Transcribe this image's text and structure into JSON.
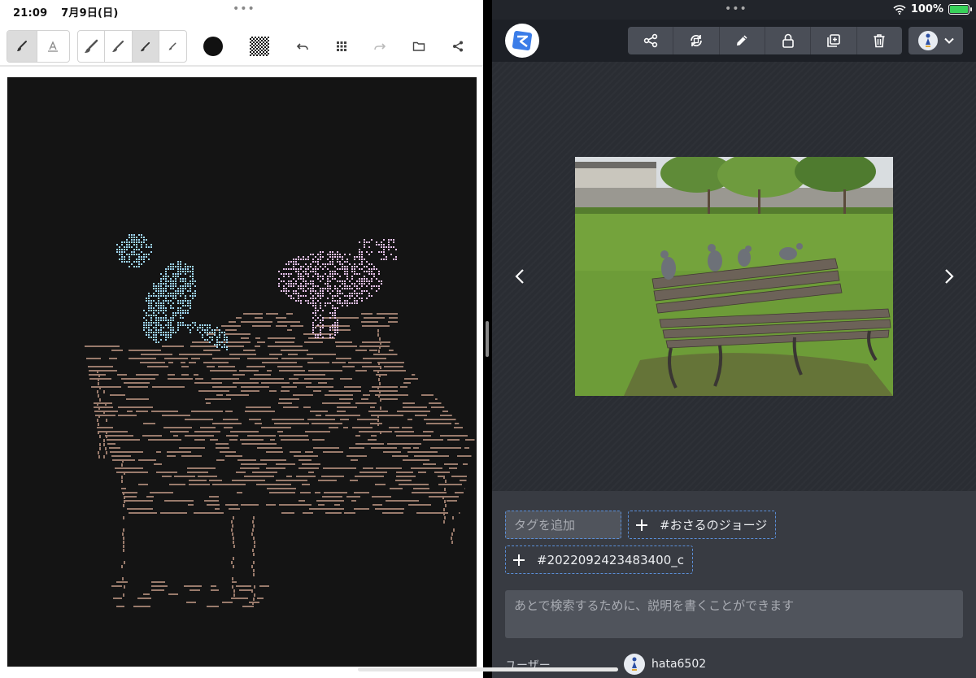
{
  "status_bar": {
    "time": "21:09",
    "date": "7月9日(日)",
    "battery": "100%",
    "battery_level": 1.0
  },
  "drawing_app": {
    "toolbar": {
      "mode_buttons": [
        {
          "icon": "brush-icon",
          "active": true
        },
        {
          "icon": "text-icon",
          "active": false
        }
      ],
      "brush_sizes": [
        {
          "icon": "brush-large-icon",
          "active": false
        },
        {
          "icon": "brush-medium-icon",
          "active": false
        },
        {
          "icon": "brush-small-icon",
          "active": true
        },
        {
          "icon": "brush-tiny-icon",
          "active": false
        }
      ],
      "current_color": "#111111",
      "icons": [
        "undo-icon",
        "grid-icon",
        "redo-icon",
        "folder-icon",
        "share-icon"
      ]
    },
    "canvas_background": "#141414",
    "stroke_colors": {
      "bird_left": "#9fd6f2",
      "bird_right": "#e6c2ea",
      "bench": "#9a7b6c"
    }
  },
  "viewer_app": {
    "header": {
      "actions": [
        "share-icon",
        "rotate-icon",
        "edit-icon",
        "lock-icon",
        "add-to-album-icon",
        "trash-icon"
      ]
    },
    "photo": {
      "subject": "pigeons on park bench"
    },
    "tags": {
      "input_placeholder": "タグを追加",
      "items": [
        {
          "label": "#おさるのジョージ"
        },
        {
          "label": "#2022092423483400_c"
        }
      ]
    },
    "description_placeholder": "あとで検索するために、説明を書くことができます",
    "user_label": "ユーザー",
    "user_name": "hata6502"
  }
}
